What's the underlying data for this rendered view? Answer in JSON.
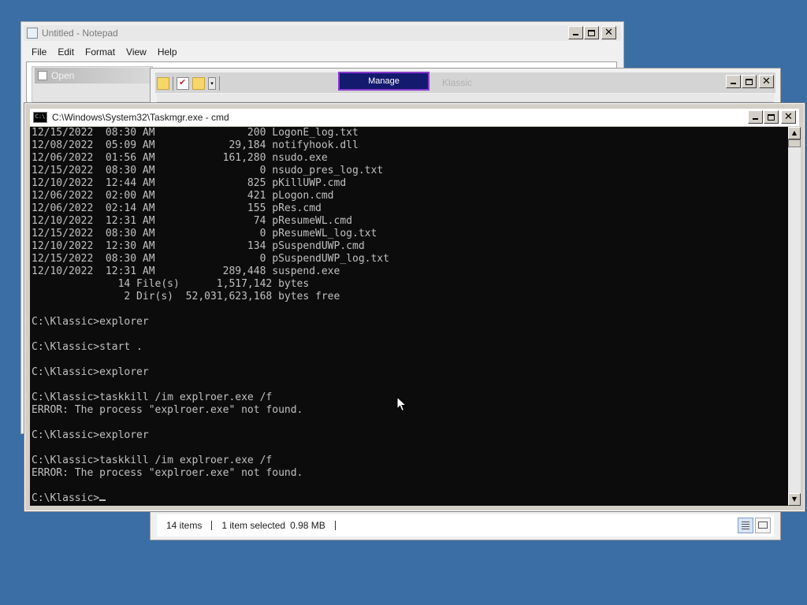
{
  "notepad": {
    "title": "Untitled - Notepad",
    "menu": [
      "File",
      "Edit",
      "Format",
      "View",
      "Help"
    ],
    "open_dialog_title": "Open"
  },
  "explorer": {
    "title": "Klassic",
    "ribbon_tab": "Manage",
    "status": {
      "item_count": "14 items",
      "selection": "1 item selected",
      "size": "0.98 MB"
    }
  },
  "console": {
    "title": "C:\\Windows\\System32\\Taskmgr.exe - cmd",
    "lines": [
      "12/15/2022  08:30 AM               200 LogonE_log.txt",
      "12/08/2022  05:09 AM            29,184 notifyhook.dll",
      "12/06/2022  01:56 AM           161,280 nsudo.exe",
      "12/15/2022  08:30 AM                 0 nsudo_pres_log.txt",
      "12/10/2022  12:44 AM               825 pKillUWP.cmd",
      "12/06/2022  02:00 AM               421 pLogon.cmd",
      "12/06/2022  02:14 AM               155 pRes.cmd",
      "12/10/2022  12:31 AM                74 pResumeWL.cmd",
      "12/15/2022  08:30 AM                 0 pResumeWL_log.txt",
      "12/10/2022  12:30 AM               134 pSuspendUWP.cmd",
      "12/15/2022  08:30 AM                 0 pSuspendUWP_log.txt",
      "12/10/2022  12:31 AM           289,448 suspend.exe",
      "              14 File(s)      1,517,142 bytes",
      "               2 Dir(s)  52,031,623,168 bytes free",
      "",
      "C:\\Klassic>explorer",
      "",
      "C:\\Klassic>start .",
      "",
      "C:\\Klassic>explorer",
      "",
      "C:\\Klassic>taskkill /im explroer.exe /f",
      "ERROR: The process \"explroer.exe\" not found.",
      "",
      "C:\\Klassic>explorer",
      "",
      "C:\\Klassic>taskkill /im explroer.exe /f",
      "ERROR: The process \"explroer.exe\" not found.",
      ""
    ],
    "prompt": "C:\\Klassic>"
  },
  "icons": {
    "notepad": "notepad-icon",
    "cmd": "cmd-icon",
    "folder": "folder-icon",
    "properties": "properties-icon",
    "mouse": "mouse-pointer-icon"
  },
  "colors": {
    "desktop": "#3a6ea5",
    "manage_tab_bg": "#141a6e",
    "manage_tab_border": "#8a3ad0",
    "console_bg": "#0c0c0c",
    "console_fg": "#c0c0c0"
  }
}
